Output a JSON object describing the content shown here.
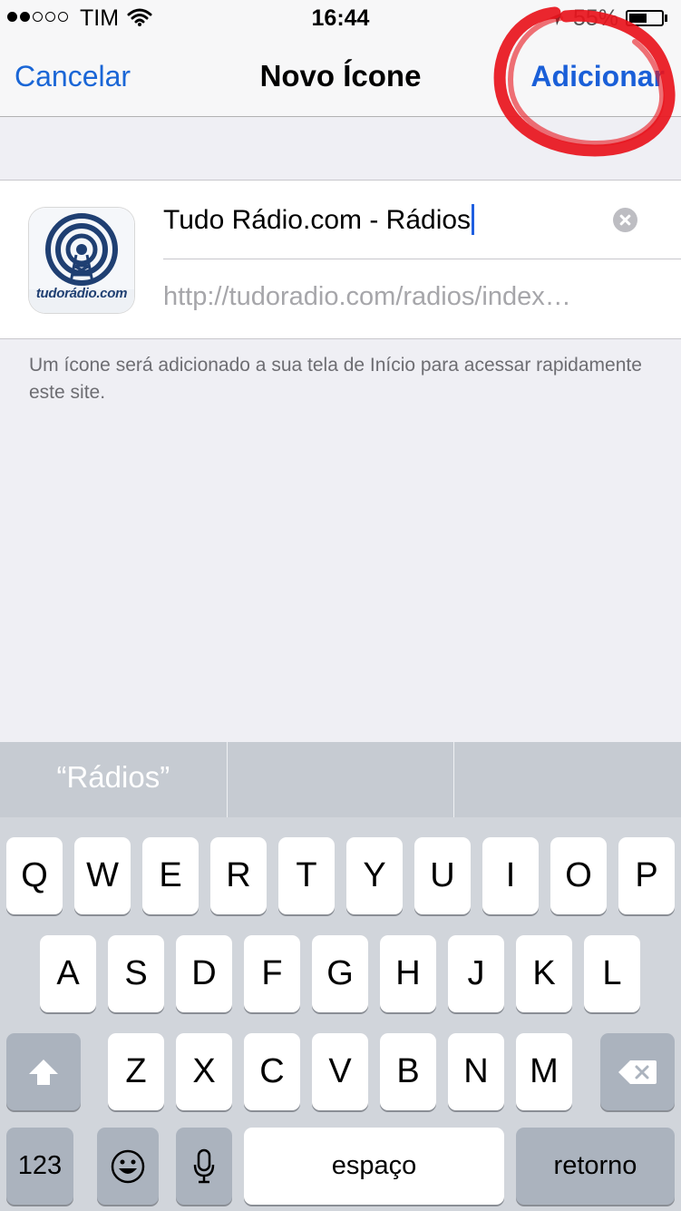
{
  "status_bar": {
    "carrier": "TIM",
    "time": "16:44",
    "battery_text": "55%",
    "battery_level": 0.55,
    "signal_bars_filled": 2,
    "signal_bars_total": 5
  },
  "nav": {
    "cancel_label": "Cancelar",
    "title": "Novo Ícone",
    "add_label": "Adicionar"
  },
  "form": {
    "title_value": "Tudo Rádio.com - Rádios",
    "url_value": "http://tudoradio.com/radios/index…",
    "icon_text": "tudorádio.com"
  },
  "footnote": "Um ícone será adicionado a sua tela de Início para acessar rapidamente este site.",
  "keyboard": {
    "suggestions": [
      "“Rádios”",
      "",
      ""
    ],
    "row1": [
      "Q",
      "W",
      "E",
      "R",
      "T",
      "Y",
      "U",
      "I",
      "O",
      "P"
    ],
    "row2": [
      "A",
      "S",
      "D",
      "F",
      "G",
      "H",
      "J",
      "K",
      "L"
    ],
    "row3": [
      "Z",
      "X",
      "C",
      "V",
      "B",
      "N",
      "M"
    ],
    "numbers_label": "123",
    "space_label": "espaço",
    "return_label": "retorno"
  },
  "colors": {
    "accent": "#1a66d6",
    "annotation": "#e8141c"
  }
}
